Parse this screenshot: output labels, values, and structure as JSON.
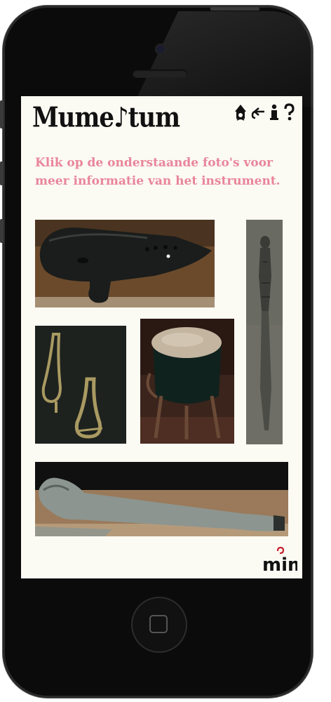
{
  "app": {
    "logo_text": "Mume♪tum",
    "intro_text": "Klik op de onderstaande foto's voor meer informatie van het instrument.",
    "footer_logo": "mim"
  },
  "top_icons": [
    "home-icon",
    "back-icon",
    "info-icon",
    "help-icon"
  ],
  "photos": [
    {
      "name": "ocarina-photo",
      "subject": "ocarina"
    },
    {
      "name": "carved-staff-photo",
      "subject": "carved staff"
    },
    {
      "name": "jaw-harps-photo",
      "subject": "jaw harps"
    },
    {
      "name": "drum-photo",
      "subject": "drum"
    },
    {
      "name": "horn-photo",
      "subject": "horn"
    }
  ],
  "colors": {
    "screen_bg": "#fbfaf3",
    "intro_text": "#e9859a",
    "logo_text": "#111111",
    "phone": "#0b0b0b",
    "mim_accent": "#c8202e"
  }
}
